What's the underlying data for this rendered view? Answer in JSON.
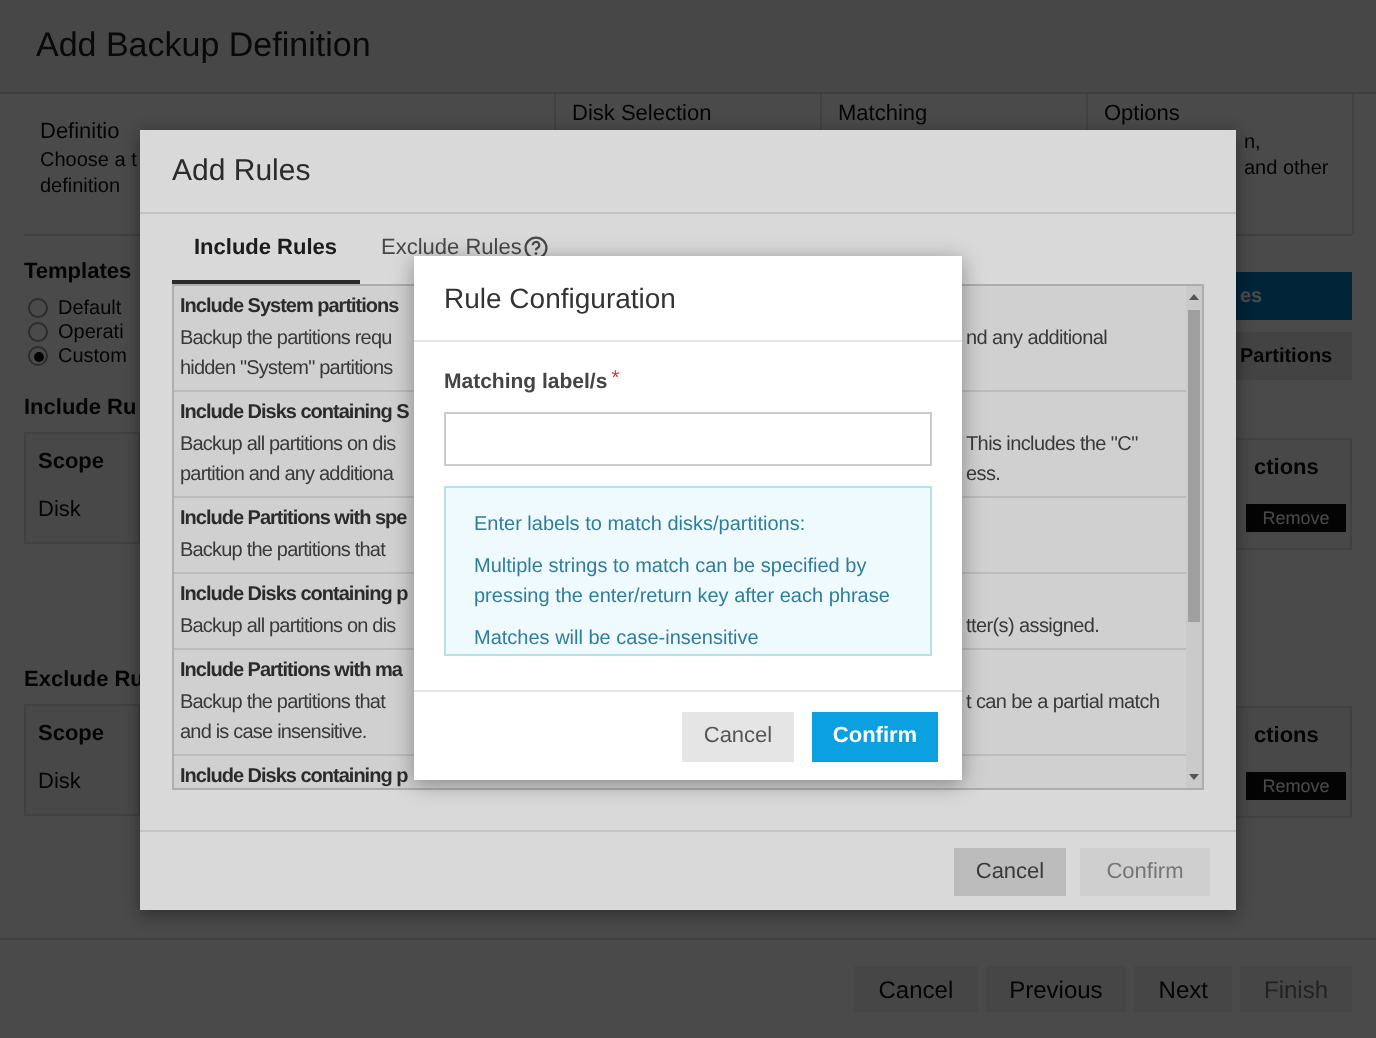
{
  "page": {
    "title": "Add Backup Definition",
    "steps": [
      {
        "title": "Definitio",
        "description": [
          "Choose a t",
          "definition"
        ]
      },
      {
        "title": "Disk Selection"
      },
      {
        "title": "Matching"
      },
      {
        "title": "Options",
        "description": [
          "n,",
          "and other"
        ]
      }
    ],
    "templates": {
      "heading": "Templates",
      "options": [
        {
          "label": "Default",
          "selected": false
        },
        {
          "label": "Operati",
          "selected": false
        },
        {
          "label": "Custom",
          "selected": true
        }
      ]
    },
    "include_rules": {
      "heading": "Include Ru",
      "column_1": "Scope",
      "cell": "Disk",
      "column_actions": "ctions",
      "remove": "Remove"
    },
    "exclude_rules": {
      "heading": "Exclude Ru",
      "column_1": "Scope",
      "cell": "Disk",
      "column_actions": "ctions",
      "remove": "Remove"
    },
    "side_buttons": [
      {
        "label": "es",
        "kind": "primary"
      },
      {
        "label": "Partitions",
        "kind": "secondary"
      }
    ],
    "footer_buttons": [
      {
        "label": "Cancel",
        "disabled": false
      },
      {
        "label": "Previous",
        "disabled": false
      },
      {
        "label": "Next",
        "disabled": false
      },
      {
        "label": "Finish",
        "disabled": true
      }
    ]
  },
  "add_rules": {
    "title": "Add Rules",
    "tabs": [
      {
        "label": "Include Rules",
        "selected": true,
        "help": false
      },
      {
        "label": "Exclude Rules",
        "selected": false,
        "help": true
      }
    ],
    "rules": [
      {
        "title": "Include System partitions",
        "lines": [
          {
            "left": "Backup the partitions requ",
            "right": "nd any additional"
          },
          {
            "left": "hidden \"System\" partitions"
          }
        ]
      },
      {
        "title": "Include Disks containing S",
        "lines": [
          {
            "left": "Backup all partitions on dis",
            "right": "This includes the \"C\""
          },
          {
            "left": "partition and any additiona",
            "right": "ess."
          }
        ]
      },
      {
        "title": "Include Partitions with spe",
        "lines": [
          {
            "left": "Backup the partitions that"
          }
        ]
      },
      {
        "title": "Include Disks containing p",
        "lines": [
          {
            "left": "Backup all partitions on dis",
            "right": "tter(s) assigned."
          }
        ]
      },
      {
        "title": "Include Partitions with ma",
        "lines": [
          {
            "left": "Backup the partitions that",
            "right": "t can be a partial match"
          },
          {
            "left": "and is case insensitive."
          }
        ]
      },
      {
        "title": "Include Disks containing p"
      }
    ],
    "buttons": [
      {
        "label": "Cancel",
        "disabled": false
      },
      {
        "label": "Confirm",
        "disabled": true
      }
    ]
  },
  "rule_configuration": {
    "title": "Rule Configuration",
    "field_label": "Matching label/s",
    "required_mark": "*",
    "info": [
      "Enter labels to match disks/partitions:",
      "Multiple strings to match can be specified by pressing the enter/return key after each phrase",
      "Matches will be case-insensitive"
    ],
    "buttons": [
      {
        "label": "Cancel",
        "kind": "secondary"
      },
      {
        "label": "Confirm",
        "kind": "primary"
      }
    ]
  }
}
